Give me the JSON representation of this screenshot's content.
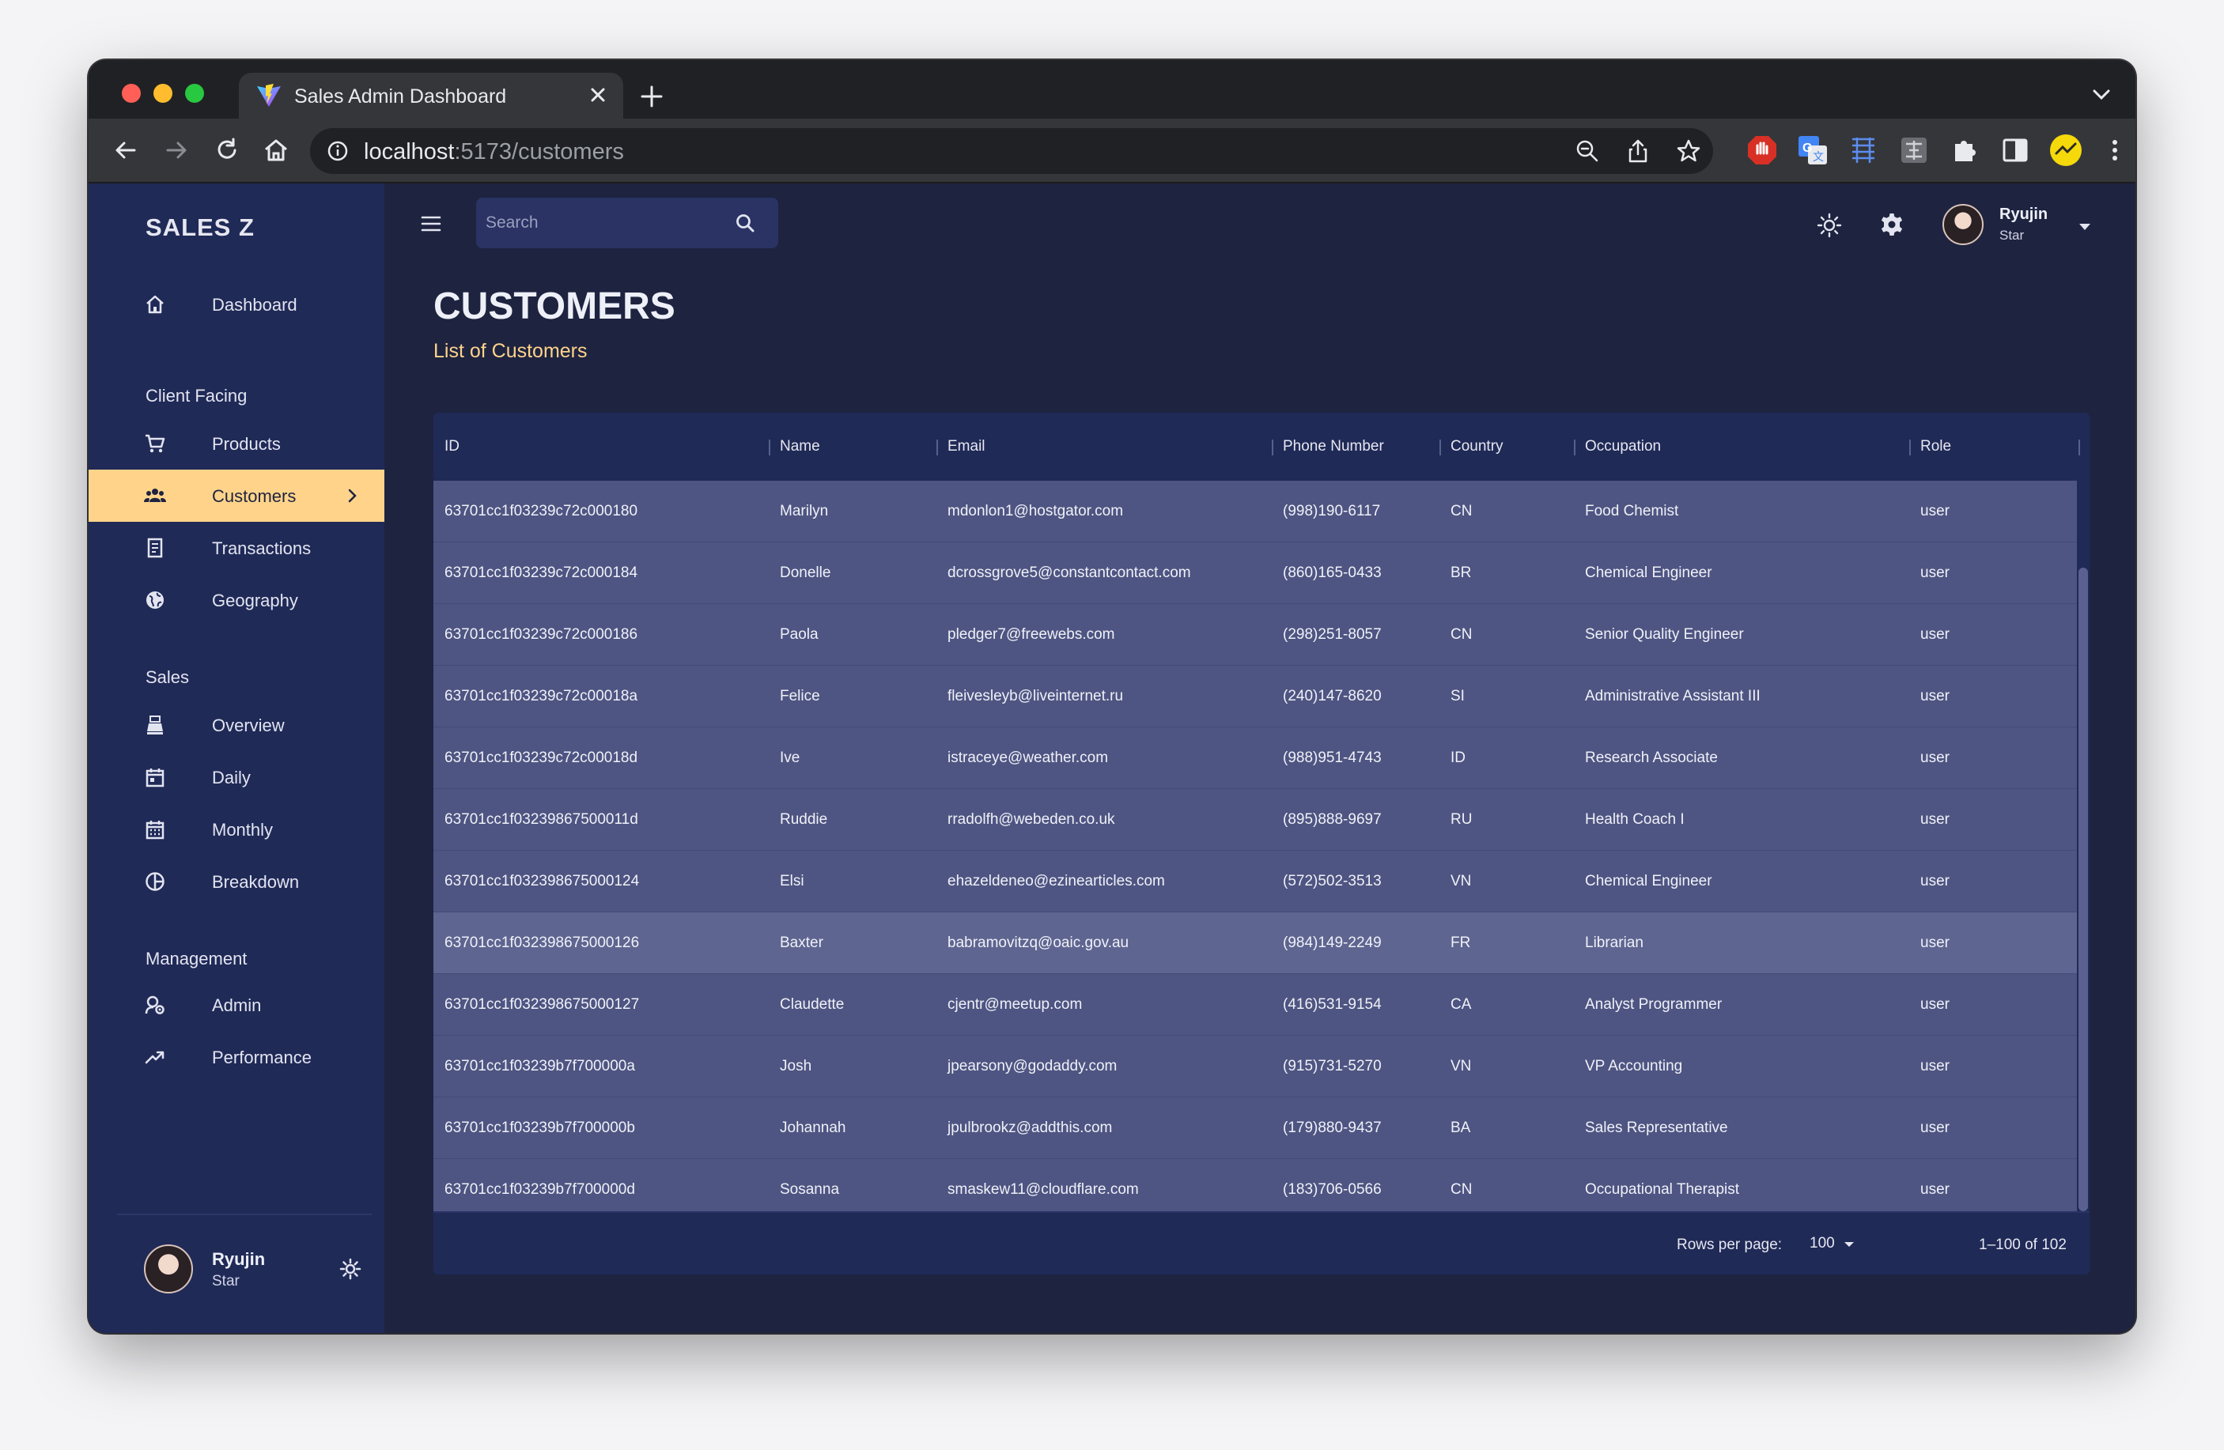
{
  "browser": {
    "tab_title": "Sales Admin Dashboard",
    "url_host": "localhost",
    "url_path": ":5173/customers"
  },
  "sidebar": {
    "brand": "SALES Z",
    "items": [
      {
        "label": "Dashboard",
        "icon": "home-icon"
      },
      {
        "label": "Products",
        "icon": "shopping-cart-icon"
      },
      {
        "label": "Customers",
        "icon": "groups-icon",
        "active": true
      },
      {
        "label": "Transactions",
        "icon": "receipt-icon"
      },
      {
        "label": "Geography",
        "icon": "globe-icon"
      },
      {
        "label": "Overview",
        "icon": "point-of-sale-icon"
      },
      {
        "label": "Daily",
        "icon": "calendar-today-icon"
      },
      {
        "label": "Monthly",
        "icon": "calendar-month-icon"
      },
      {
        "label": "Breakdown",
        "icon": "pie-chart-icon"
      },
      {
        "label": "Admin",
        "icon": "admin-settings-icon"
      },
      {
        "label": "Performance",
        "icon": "trending-up-icon"
      }
    ],
    "sections": [
      "Client Facing",
      "Sales",
      "Management"
    ],
    "user": {
      "name": "Ryujin",
      "role": "Star"
    }
  },
  "topbar": {
    "search_placeholder": "Search",
    "user": {
      "name": "Ryujin",
      "role": "Star"
    }
  },
  "page": {
    "title": "CUSTOMERS",
    "subtitle": "List of Customers"
  },
  "table": {
    "columns": [
      "ID",
      "Name",
      "Email",
      "Phone Number",
      "Country",
      "Occupation",
      "Role"
    ],
    "rows": [
      [
        "63701cc1f03239c72c000180",
        "Marilyn",
        "mdonlon1@hostgator.com",
        "(998)190-6117",
        "CN",
        "Food Chemist",
        "user"
      ],
      [
        "63701cc1f03239c72c000184",
        "Donelle",
        "dcrossgrove5@constantcontact.com",
        "(860)165-0433",
        "BR",
        "Chemical Engineer",
        "user"
      ],
      [
        "63701cc1f03239c72c000186",
        "Paola",
        "pledger7@freewebs.com",
        "(298)251-8057",
        "CN",
        "Senior Quality Engineer",
        "user"
      ],
      [
        "63701cc1f03239c72c00018a",
        "Felice",
        "fleivesleyb@liveinternet.ru",
        "(240)147-8620",
        "SI",
        "Administrative Assistant III",
        "user"
      ],
      [
        "63701cc1f03239c72c00018d",
        "Ive",
        "istraceye@weather.com",
        "(988)951-4743",
        "ID",
        "Research Associate",
        "user"
      ],
      [
        "63701cc1f03239867500011d",
        "Ruddie",
        "rradolfh@webeden.co.uk",
        "(895)888-9697",
        "RU",
        "Health Coach I",
        "user"
      ],
      [
        "63701cc1f032398675000124",
        "Elsi",
        "ehazeldeneo@ezinearticles.com",
        "(572)502-3513",
        "VN",
        "Chemical Engineer",
        "user"
      ],
      [
        "63701cc1f032398675000126",
        "Baxter",
        "babramovitzq@oaic.gov.au",
        "(984)149-2249",
        "FR",
        "Librarian",
        "user"
      ],
      [
        "63701cc1f032398675000127",
        "Claudette",
        "cjentr@meetup.com",
        "(416)531-9154",
        "CA",
        "Analyst Programmer",
        "user"
      ],
      [
        "63701cc1f03239b7f700000a",
        "Josh",
        "jpearsony@godaddy.com",
        "(915)731-5270",
        "VN",
        "VP Accounting",
        "user"
      ],
      [
        "63701cc1f03239b7f700000b",
        "Johannah",
        "jpulbrookz@addthis.com",
        "(179)880-9437",
        "BA",
        "Sales Representative",
        "user"
      ],
      [
        "63701cc1f03239b7f700000d",
        "Sosanna",
        "smaskew11@cloudflare.com",
        "(183)706-0566",
        "CN",
        "Occupational Therapist",
        "user"
      ]
    ],
    "hover_row": 7,
    "footer": {
      "rows_per_page_label": "Rows per page:",
      "rows_per_page_value": "100",
      "range": "1–100 of 102"
    }
  },
  "colors": {
    "sidebar_bg": "#202a57",
    "content_bg": "#1e2340",
    "accent": "#ffd48a",
    "row_bg": "#4e5582"
  }
}
